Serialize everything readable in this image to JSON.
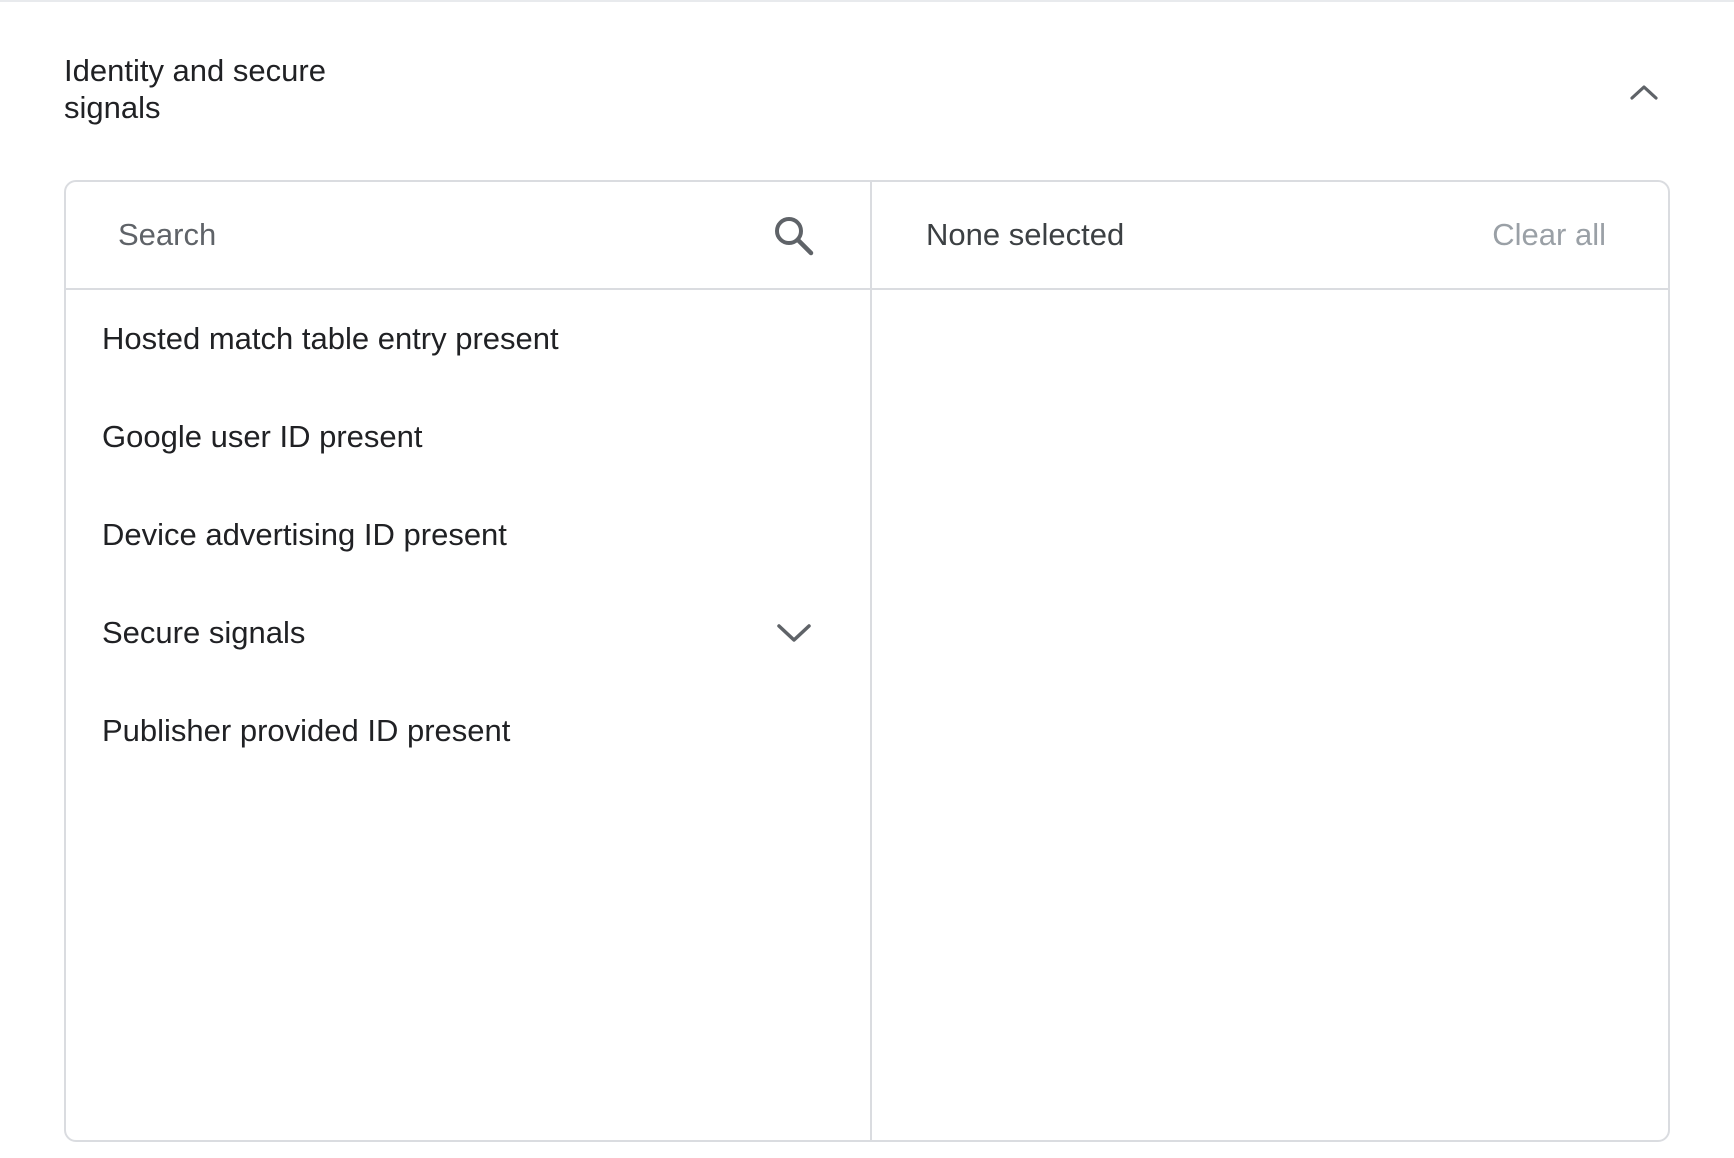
{
  "section": {
    "title": "Identity and secure signals",
    "collapse_icon": "chevron-up-icon"
  },
  "search": {
    "placeholder": "Search",
    "value": "",
    "icon": "search-icon"
  },
  "selected_panel": {
    "status": "None selected",
    "clear_all_label": "Clear all"
  },
  "options": [
    {
      "label": "Hosted match table entry present",
      "expandable": false
    },
    {
      "label": "Google user ID present",
      "expandable": false
    },
    {
      "label": "Device advertising ID present",
      "expandable": false
    },
    {
      "label": "Secure signals",
      "expandable": true,
      "icon": "chevron-down-icon"
    },
    {
      "label": "Publisher provided ID present",
      "expandable": false
    }
  ],
  "colors": {
    "border": "#dadce0",
    "text_primary": "#202124",
    "text_muted": "#9aa0a6",
    "icon": "#5f6368"
  }
}
